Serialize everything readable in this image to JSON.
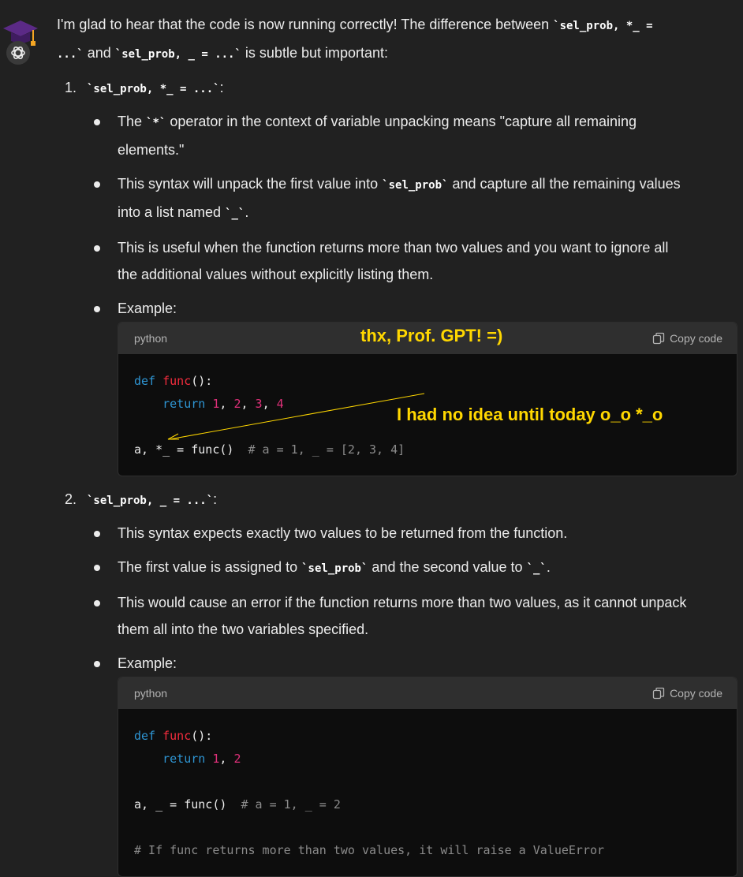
{
  "intro": {
    "p1": "I'm glad to hear that the code is now running correctly! The difference between ",
    "code1": "`sel_prob, *_ =",
    "code1b": "...`",
    "p2": " and ",
    "code2": "`sel_prob, _ = ...`",
    "p3": " is subtle but important:"
  },
  "section1": {
    "number": "1.",
    "heading_code": "`sel_prob, *_ = ...`",
    "heading_suffix": ":",
    "b1_a": "The ",
    "b1_code": "`*`",
    "b1_b": " operator in the context of variable unpacking means \"capture all remaining",
    "b1_c": "elements.\"",
    "b2_a": "This syntax will unpack the first value into ",
    "b2_code": "`sel_prob`",
    "b2_b": " and capture all the remaining values",
    "b2_c": "into a list named ",
    "b2_code2": "`_`",
    "b2_d": ".",
    "b3_a": "This is useful when the function returns more than two values and you want to ignore all",
    "b3_b": "the additional values without explicitly listing them.",
    "b4": "Example:",
    "code": {
      "lang": "python",
      "copy": "Copy code",
      "l1_kw": "def",
      "l1_fn": "func",
      "l1_rest": "():",
      "l2_kw": "return",
      "l2_n1": "1",
      "l2_n2": "2",
      "l2_n3": "3",
      "l2_n4": "4",
      "l3_code": "a, *_ = func()  ",
      "l3_comment": "# a = 1, _ = [2, 3, 4]"
    },
    "annotation_top": "thx, Prof. GPT! =)",
    "annotation_arrow": "I had no idea until today o_o  *_o"
  },
  "section2": {
    "number": "2.",
    "heading_code": "`sel_prob, _ = ...`",
    "heading_suffix": ":",
    "b1": "This syntax expects exactly two values to be returned from the function.",
    "b2_a": "The first value is assigned to ",
    "b2_code": "`sel_prob`",
    "b2_b": " and the second value to ",
    "b2_code2": "`_`",
    "b2_c": ".",
    "b3_a": "This would cause an error if the function returns more than two values, as it cannot unpack",
    "b3_b": "them all into the two variables specified.",
    "b4": "Example:",
    "code": {
      "lang": "python",
      "copy": "Copy code",
      "l1_kw": "def",
      "l1_fn": "func",
      "l1_rest": "():",
      "l2_kw": "return",
      "l2_n1": "1",
      "l2_n2": "2",
      "l3_code": "a, _ = func()  ",
      "l3_comment": "# a = 1, _ = 2",
      "l4_comment": "# If func returns more than two values, it will raise a ValueError"
    }
  },
  "colors": {
    "background": "#212121",
    "code_bg": "#0d0d0d",
    "annotation": "#ffd700",
    "keyword": "#2e95d3",
    "function": "#f22c3d",
    "number": "#df3079"
  }
}
